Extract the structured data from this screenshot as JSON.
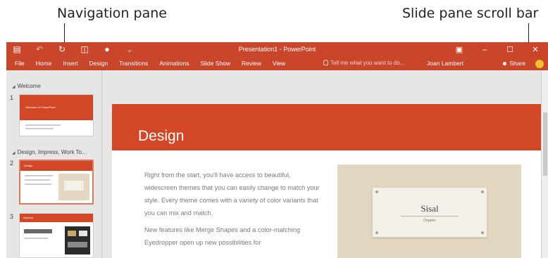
{
  "callouts": {
    "navigation_pane": "Navigation pane",
    "slide_pane_scroll_bar": "Slide pane scroll bar"
  },
  "window": {
    "title": "Presentation1 - PowerPoint",
    "user": "Joan Lambert",
    "share_label": "Share",
    "tell_me_placeholder": "Tell me what you want to do...",
    "accent_color": "#c9462b"
  },
  "ribbon_tabs": [
    "File",
    "Home",
    "Insert",
    "Design",
    "Transitions",
    "Animations",
    "Slide Show",
    "Review",
    "View"
  ],
  "navigation_pane": {
    "sections": [
      {
        "name": "Welcome",
        "slides": [
          "1"
        ]
      },
      {
        "name": "Design, Impress, Work To...",
        "slides": [
          "2",
          "3"
        ]
      }
    ],
    "thumbnail_1_title": "Welcome to PowerPoint",
    "thumbnail_2_title": "Design",
    "thumbnail_3_title": "Impress"
  },
  "slide": {
    "title": "Design",
    "paragraphs": [
      "Right from the start, you'll have access to beautiful, widescreen themes that you can easily change to match your style. Every theme comes with a variety of color variants that you can mix and match.",
      "New features like Merge Shapes and a color-matching Eyedropper open up new possibilities for"
    ],
    "theme_card_name": "Sisal",
    "theme_card_subtitle": "Organic",
    "banner_color": "#d24726"
  }
}
